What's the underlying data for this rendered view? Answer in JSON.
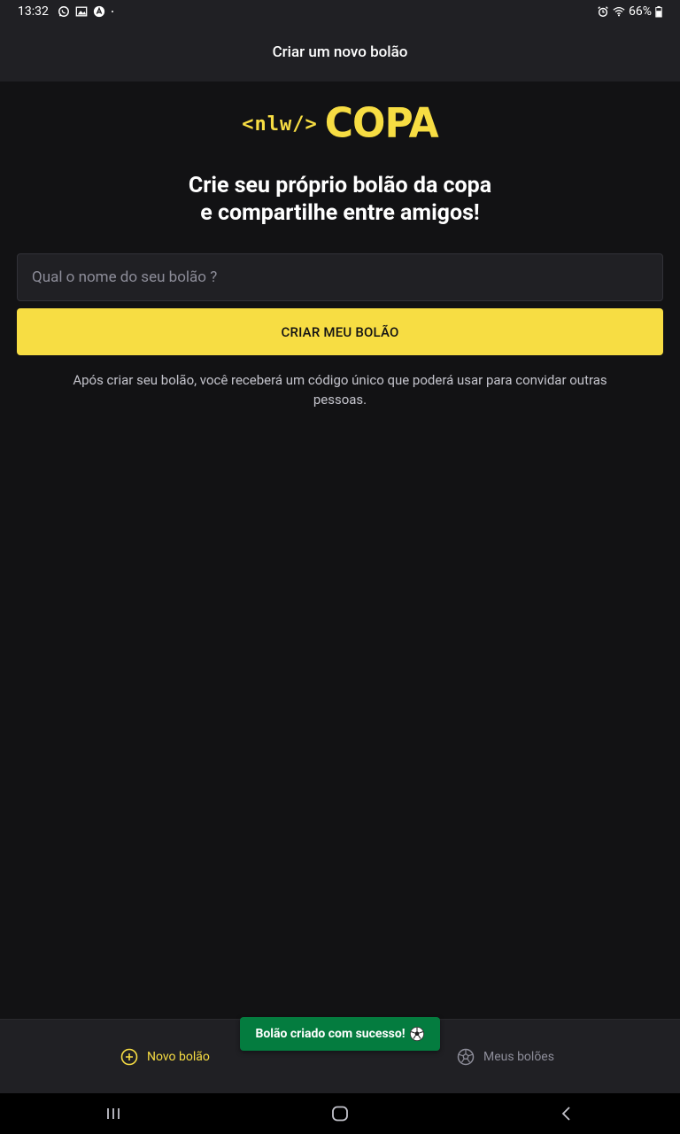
{
  "status_bar": {
    "time": "13:32",
    "battery": "66%",
    "icons": [
      "whatsapp-icon",
      "image-icon",
      "app-icon",
      "dot-icon",
      "alarm-icon",
      "wifi-icon",
      "battery-icon"
    ]
  },
  "header": {
    "title": "Criar um novo bolão"
  },
  "logo": {
    "code_text": "<nlw/>",
    "brand_text": "COPA"
  },
  "headline": {
    "line1": "Crie seu próprio bolão da copa",
    "line2": "e compartilhe entre amigos!"
  },
  "form": {
    "input_placeholder": "Qual o nome do seu bolão ?",
    "button_label": "CRIAR MEU BOLÃO"
  },
  "info_text": "Após criar seu bolão, você receberá um código único que poderá usar para convidar outras pessoas.",
  "tabs": [
    {
      "label": "Novo bolão",
      "icon": "plus-circle-icon",
      "active": true
    },
    {
      "label": "Meus bolões",
      "icon": "soccer-ball-icon",
      "active": false
    }
  ],
  "toast": {
    "message": "Bolão criado com sucesso!",
    "icon": "soccer-ball-icon"
  },
  "colors": {
    "accent": "#f7dd43",
    "background": "#121214",
    "surface": "#202024",
    "toast": "#047c3f"
  }
}
